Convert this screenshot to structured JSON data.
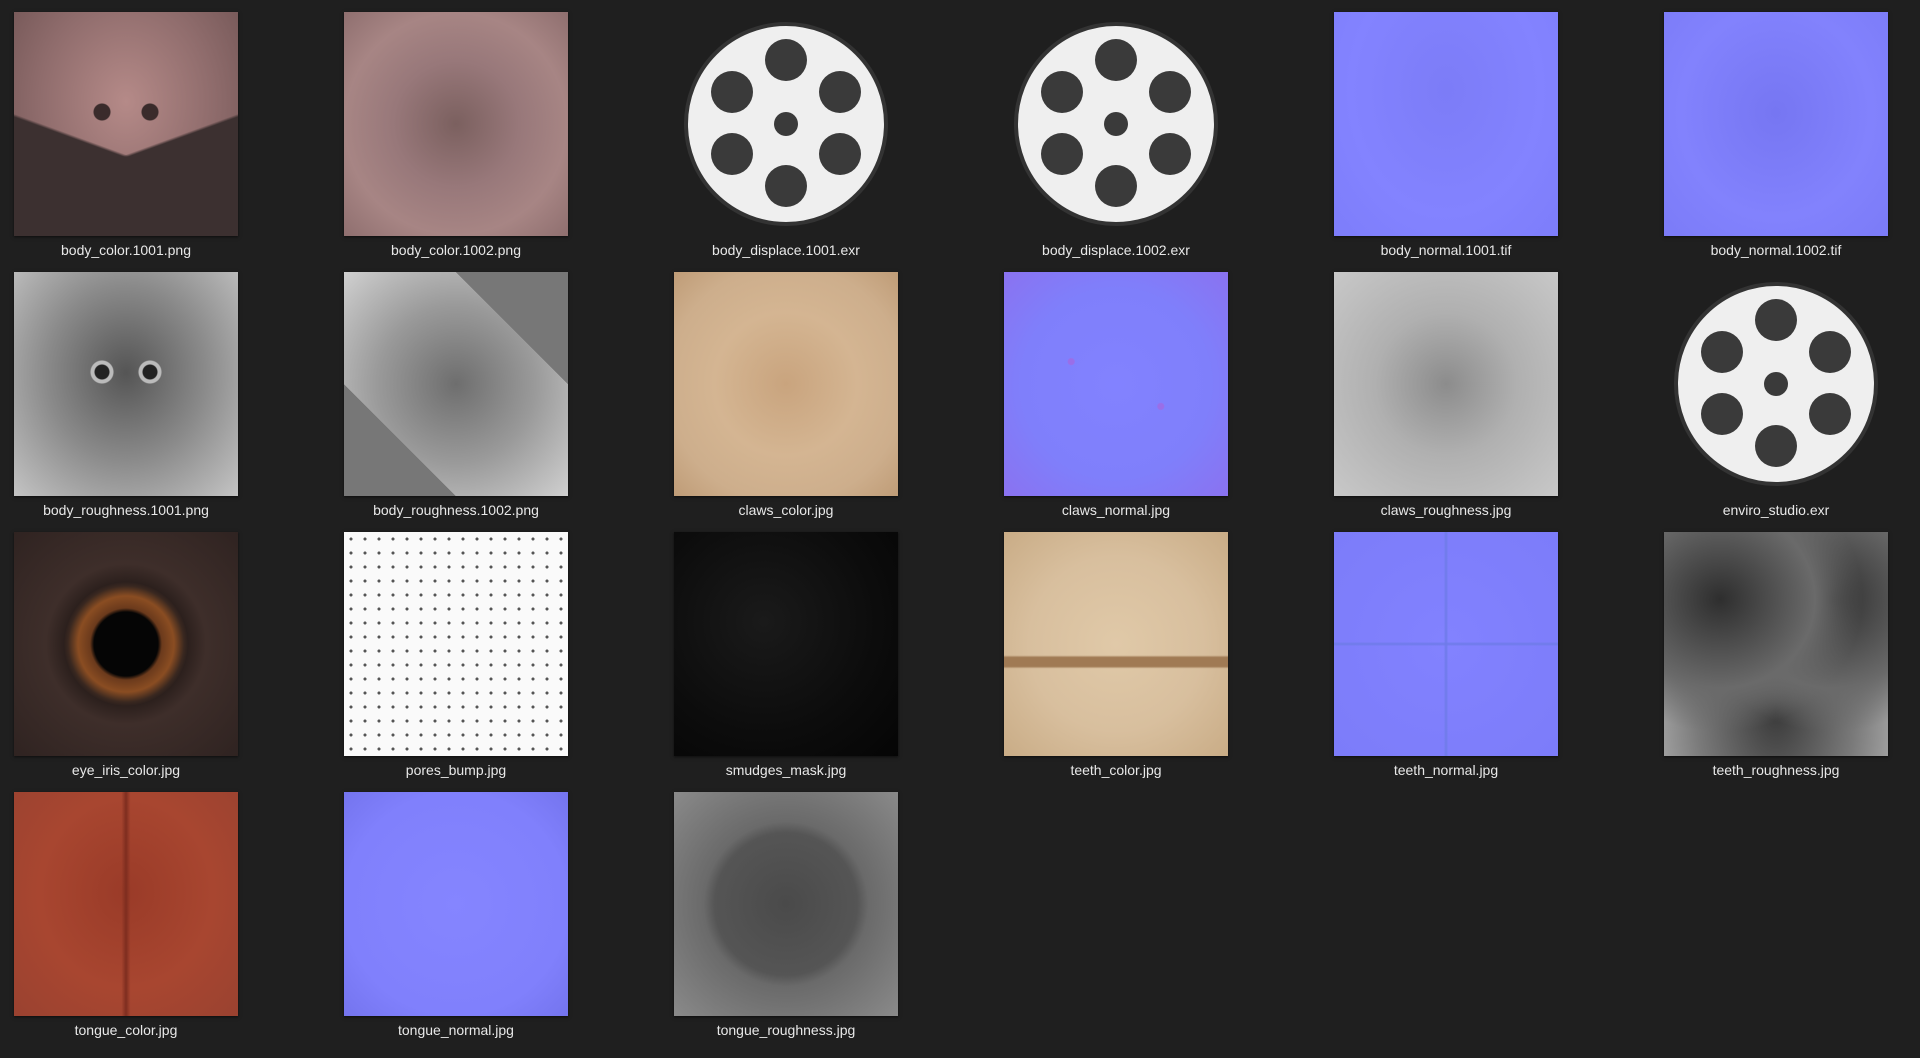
{
  "files": [
    {
      "name": "body_color.1001.png",
      "kind": "image",
      "texture": "t-bodycolor1"
    },
    {
      "name": "body_color.1002.png",
      "kind": "image",
      "texture": "t-bodycolor2"
    },
    {
      "name": "body_displace.1001.exr",
      "kind": "film-reel-icon"
    },
    {
      "name": "body_displace.1002.exr",
      "kind": "film-reel-icon"
    },
    {
      "name": "body_normal.1001.tif",
      "kind": "image",
      "texture": "t-normal1"
    },
    {
      "name": "body_normal.1002.tif",
      "kind": "image",
      "texture": "t-normal2"
    },
    {
      "name": "body_roughness.1001.png",
      "kind": "image",
      "texture": "t-rough1"
    },
    {
      "name": "body_roughness.1002.png",
      "kind": "image",
      "texture": "t-rough2"
    },
    {
      "name": "claws_color.jpg",
      "kind": "image",
      "texture": "t-clawscolor"
    },
    {
      "name": "claws_normal.jpg",
      "kind": "image",
      "texture": "t-clawsnormal"
    },
    {
      "name": "claws_roughness.jpg",
      "kind": "image",
      "texture": "t-clawsrough"
    },
    {
      "name": "enviro_studio.exr",
      "kind": "film-reel-icon"
    },
    {
      "name": "eye_iris_color.jpg",
      "kind": "image",
      "texture": "t-iris"
    },
    {
      "name": "pores_bump.jpg",
      "kind": "image",
      "texture": "t-pores"
    },
    {
      "name": "smudges_mask.jpg",
      "kind": "image",
      "texture": "t-smudges"
    },
    {
      "name": "teeth_color.jpg",
      "kind": "image",
      "texture": "t-teethcolor"
    },
    {
      "name": "teeth_normal.jpg",
      "kind": "image",
      "texture": "t-teethnormal"
    },
    {
      "name": "teeth_roughness.jpg",
      "kind": "image",
      "texture": "t-teethrough"
    },
    {
      "name": "tongue_color.jpg",
      "kind": "image",
      "texture": "t-tonguecolor"
    },
    {
      "name": "tongue_normal.jpg",
      "kind": "image",
      "texture": "t-tonguenormal"
    },
    {
      "name": "tongue_roughness.jpg",
      "kind": "image",
      "texture": "t-tonguerough"
    }
  ],
  "colors": {
    "background": "#1f1f1f",
    "label": "#e8e8e8",
    "reel_disc": "#efefef",
    "reel_holes": "#3a3a3a"
  }
}
